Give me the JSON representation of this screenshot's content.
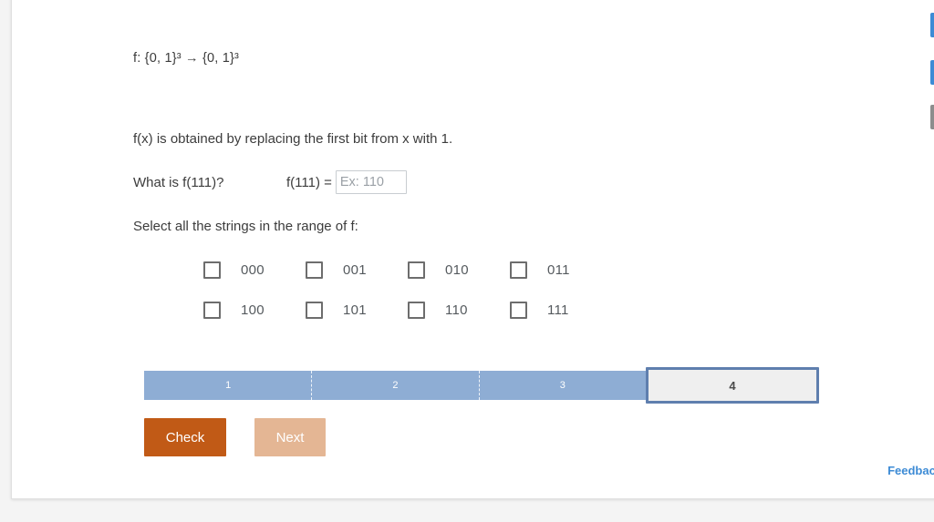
{
  "problem": {
    "function_signature": "f: {0, 1}³ → {0, 1}³",
    "statement": "f(x) is obtained by replacing the first bit from x with 1.",
    "question": "What is f(111)?",
    "answer_equation_label": "f(111) =",
    "answer_value": "",
    "answer_placeholder": "Ex: 110"
  },
  "select_all": {
    "prompt": "Select all the strings in the range of f:",
    "rows": [
      [
        {
          "label": "000",
          "checked": false
        },
        {
          "label": "001",
          "checked": false
        },
        {
          "label": "010",
          "checked": false
        },
        {
          "label": "011",
          "checked": false
        }
      ],
      [
        {
          "label": "100",
          "checked": false
        },
        {
          "label": "101",
          "checked": false
        },
        {
          "label": "110",
          "checked": false
        },
        {
          "label": "111",
          "checked": false
        }
      ]
    ]
  },
  "progress": {
    "steps": [
      {
        "label": "1",
        "state": "done"
      },
      {
        "label": "2",
        "state": "done"
      },
      {
        "label": "3",
        "state": "done"
      },
      {
        "label": "4",
        "state": "current"
      }
    ],
    "done_color": "#8eadd4",
    "current_fill": "#efefef",
    "current_border": "#5f7fae"
  },
  "actions": {
    "check_label": "Check",
    "next_label": "Next",
    "check_color": "#c15a16",
    "next_color": "#e4b694"
  },
  "footer": {
    "feedback_label": "Feedback?",
    "feedback_color": "#3d8bd5"
  },
  "side_tabs": [
    {
      "name": "blue-tab-upper",
      "color": "#3d8bd5"
    },
    {
      "name": "blue-tab-lower",
      "color": "#3d8bd5"
    },
    {
      "name": "gray-tab",
      "color": "#8d8d8d"
    }
  ]
}
